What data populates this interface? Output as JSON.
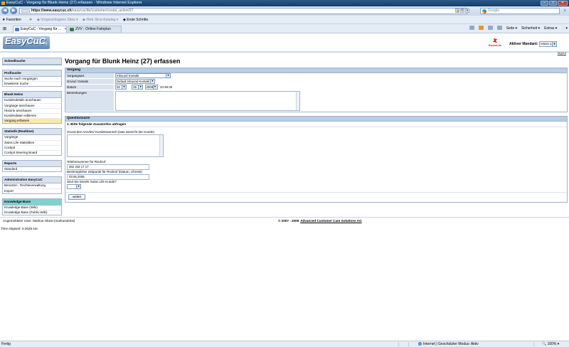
{
  "window": {
    "title": "EasyCuC - Vorgang für Blunk Heinz (27) erfassen - Windows Internet Explorer"
  },
  "addressbar": {
    "host": "https://www.easycuc.ch",
    "path": "/easycuc/de/customer/create_action/27",
    "search_placeholder": "Google"
  },
  "favorites": {
    "label": "Favoriten",
    "items": [
      "Vorgeschlagene Sites",
      "Web Slice-Katalog",
      "Erste Schritte"
    ]
  },
  "tabs": [
    {
      "label": "EasyCuC - Vorgang für ...",
      "active": true
    },
    {
      "label": "ZVV - Online Fahrplan",
      "active": false
    }
  ],
  "commandbar": {
    "seite": "Seite",
    "sicherheit": "Sicherheit",
    "extras": "Extras"
  },
  "header": {
    "logo": "EasyCuC",
    "logo_tm": "free reply",
    "swiss_life": "SwissLife",
    "mandant_label": "Aktiver Mandant:",
    "mandant_value": "Swiss Life",
    "logout": "logout"
  },
  "sidebar": {
    "schnellsuche": "Schnellsuche",
    "profisuche": {
      "title": "Profisuche",
      "items": [
        "Suche nach Vorgängen",
        "Erweiterte Suche"
      ]
    },
    "blunk": {
      "title": "Blunk Heinz",
      "items": [
        "Kundendetails anschauen",
        "Vorgänge anschauen",
        "Historie anschauen",
        "Kundendaten editieren",
        "Vorgang erfassen"
      ]
    },
    "statistik": {
      "title": "Statistik (Realtime)",
      "items": [
        "Vorgänge",
        "Swiss Life Statistiken",
        "Cockpit",
        "Cockpit Steering Board"
      ]
    },
    "reports": {
      "title": "Reports",
      "items": [
        "Standard"
      ]
    },
    "admin": {
      "title": "Administration EasyCuC",
      "items": [
        "Benutzer-, Rechteverwaltung",
        "Import"
      ]
    },
    "kb": {
      "title": "Knowledge-Base",
      "items": [
        "Knowledge-Base (Wiki)",
        "Knowledge-Base (Public-Wiki)"
      ]
    }
  },
  "main": {
    "title": "Vorgang für Blunk Heinz (27) erfassen",
    "vorgang": {
      "head": "Vorgang",
      "vorgangsart_label": "Vorgangsart",
      "vorgangsart_value": "Inbound Kontakt",
      "grund_label": "Grund / Details",
      "grund_value": "Default Inbound Kontakt",
      "datum_label": "Datum",
      "datum_day": "03",
      "datum_month": "06",
      "datum_year": "2009",
      "datum_time": "10:49:30",
      "bemerkungen_label": "Bemerkungen"
    },
    "questionnaire": {
      "head": "Questionnaire",
      "subhead": "1. Bitte folgende Zusatzinfos abfragen",
      "q1": "Grund des Anrufes/ Kundenwunsch (was wünscht der Kunde)",
      "q2": "Telefonnummer für Rückruf",
      "q2_value": "062 318 17 17",
      "q3": "Bestmöglicher Zeitpunkt für Rückruf (Datum, Uhrzeit)",
      "q3_value": "03.06.2009,",
      "q4": "Sind Sie bereits Swiss Life Kunde?",
      "q4_value": "",
      "submit": "weiter"
    }
  },
  "footer": {
    "user": "Angemeldeter User: Markus Obrist (markusobrist)",
    "copyright": "© 2007 - 2009",
    "company": "Advanced Customer Care Solutions AG",
    "elapsed": "Time elapsed: 0.2629 sec"
  },
  "statusbar": {
    "done": "Fertig",
    "zone": "Internet | Geschützter Modus: Aktiv",
    "zoom": "100%"
  }
}
